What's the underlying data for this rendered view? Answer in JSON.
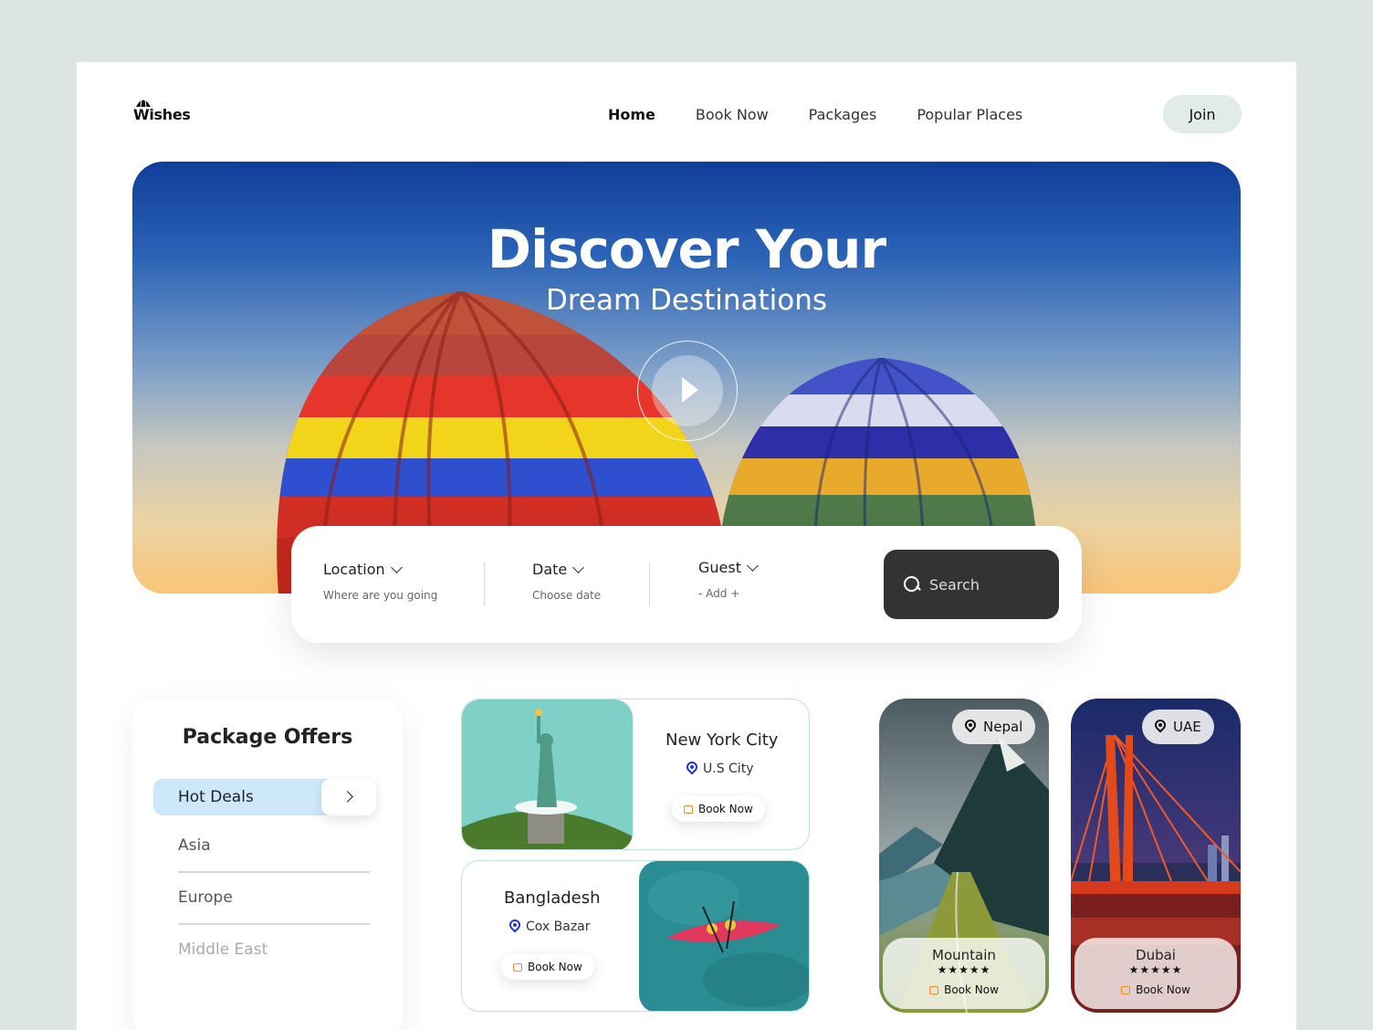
{
  "brand": {
    "name": "Wishes"
  },
  "nav": {
    "items": [
      "Home",
      "Book Now",
      "Packages",
      "Popular Places"
    ],
    "join_label": "Join"
  },
  "hero": {
    "title": "Discover Your",
    "subtitle": "Dream Destinations"
  },
  "search": {
    "location": {
      "label": "Location",
      "hint": "Where are you going"
    },
    "date": {
      "label": "Date",
      "hint": "Choose date"
    },
    "guest": {
      "label": "Guest",
      "hint": "- Add +"
    },
    "button_label": "Search"
  },
  "offers": {
    "title": "Package Offers",
    "active": "Hot Deals",
    "items": [
      "Asia",
      "Europe",
      "Middle East"
    ]
  },
  "destinations": [
    {
      "name": "New York City",
      "location": "U.S City",
      "cta": "Book Now"
    },
    {
      "name": "Bangladesh",
      "location": "Cox Bazar",
      "cta": "Book Now"
    }
  ],
  "featured": [
    {
      "badge": "Nepal",
      "name": "Mountain",
      "stars": "★★★★★",
      "cta": "Book Now"
    },
    {
      "badge": "UAE",
      "name": "Dubai",
      "stars": "★★★★★",
      "cta": "Book Now"
    }
  ],
  "colors": {
    "background": "#dce5e3",
    "join_button": "#e1ebea",
    "search_button": "#333432",
    "hot_deals": "#cde9f9",
    "pin_accent": "#1f34c9",
    "ticket_accent": "#f08a2c"
  },
  "icons": [
    "logo-parasol-icon",
    "chevron-down-icon",
    "search-icon",
    "play-icon",
    "chevron-right-icon",
    "location-pin-icon",
    "ticket-icon"
  ]
}
